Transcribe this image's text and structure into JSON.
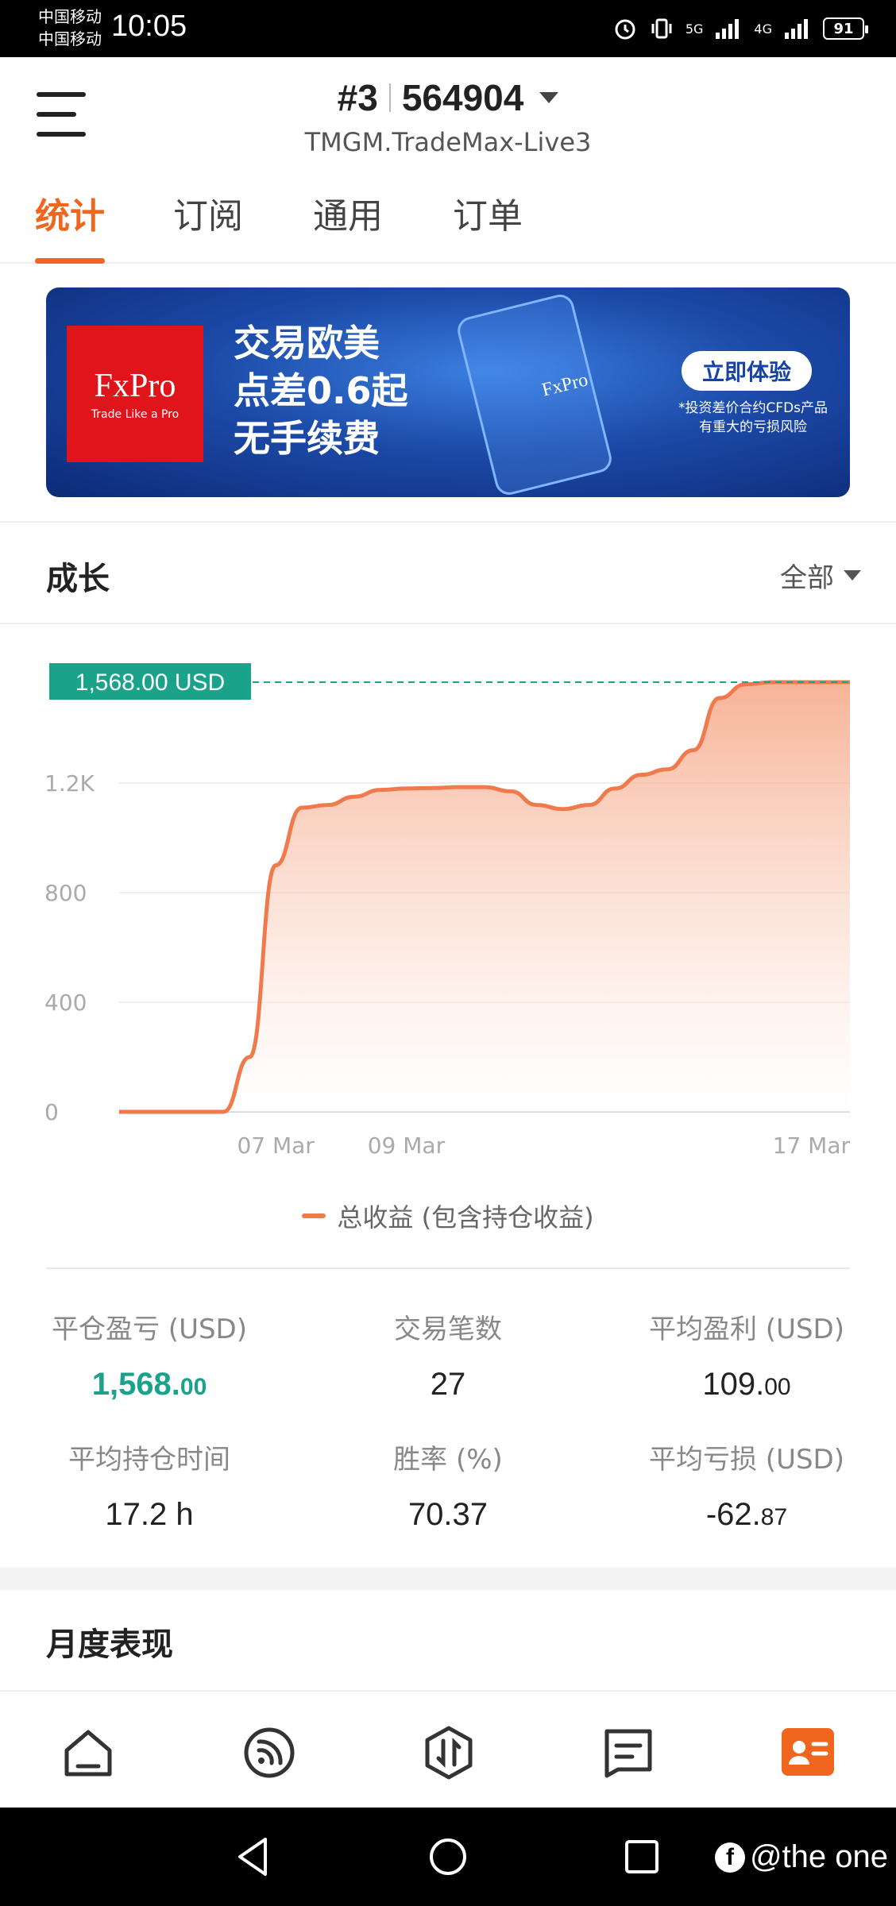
{
  "status_bar": {
    "carrier_1": "中国移动",
    "carrier_2": "中国移动",
    "time": "10:05",
    "battery": "91",
    "signal_labels": [
      "5G",
      "4G"
    ]
  },
  "header": {
    "account_prefix": "#3",
    "account_number": "564904",
    "server": "TMGM.TradeMax-Live3"
  },
  "tabs": [
    {
      "label": "统计",
      "active": true
    },
    {
      "label": "订阅",
      "active": false
    },
    {
      "label": "通用",
      "active": false
    },
    {
      "label": "订单",
      "active": false
    }
  ],
  "banner": {
    "logo": "FxPro",
    "logo_sub": "Trade Like a Pro",
    "headline_1": "交易欧美",
    "headline_2": "点差0.6起",
    "headline_3": "无手续费",
    "phone_logo": "FxPro",
    "cta": "立即体验",
    "disclaimer": "*投资差价合约CFDs产品有重大的亏损风险"
  },
  "growth": {
    "title": "成长",
    "filter": "全部",
    "legend": "总收益 (包含持仓收益)"
  },
  "chart_data": {
    "type": "area",
    "current_value_label": "1,568.00 USD",
    "y_ticks": [
      "0",
      "400",
      "800",
      "1.2K"
    ],
    "x_tick_labels": [
      "07 Mar",
      "09 Mar",
      "17 Mar"
    ],
    "ylim": [
      0,
      1600
    ],
    "series": [
      {
        "name": "总收益 (包含持仓收益)",
        "color": "#f07a4b",
        "values": [
          0,
          0,
          0,
          0,
          0,
          200,
          900,
          1110,
          1120,
          1150,
          1175,
          1180,
          1182,
          1185,
          1185,
          1170,
          1120,
          1105,
          1120,
          1180,
          1230,
          1250,
          1320,
          1510,
          1560,
          1568,
          1568,
          1568,
          1568
        ]
      }
    ],
    "grid": true
  },
  "stats": [
    {
      "label": "平仓盈亏 (USD)",
      "value_main": "1,568.",
      "value_dec": "00",
      "highlight": true
    },
    {
      "label": "交易笔数",
      "value_main": "27",
      "value_dec": "",
      "highlight": false
    },
    {
      "label": "平均盈利 (USD)",
      "value_main": "109.",
      "value_dec": "00",
      "highlight": false
    },
    {
      "label": "平均持仓时间",
      "value_main": "17.2 h",
      "value_dec": "",
      "highlight": false
    },
    {
      "label": "胜率 (%)",
      "value_main": "70.37",
      "value_dec": "",
      "highlight": false
    },
    {
      "label": "平均亏损 (USD)",
      "value_main": "-62.",
      "value_dec": "87",
      "highlight": false
    }
  ],
  "monthly": {
    "title": "月度表现"
  },
  "bottom_nav": [
    {
      "icon": "home-icon"
    },
    {
      "icon": "signal-icon"
    },
    {
      "icon": "trade-icon"
    },
    {
      "icon": "message-icon"
    },
    {
      "icon": "profile-icon",
      "active": true
    }
  ],
  "watermark": "@the one",
  "colors": {
    "accent": "#f0661f",
    "green": "#1aa28a",
    "chart_line": "#f07a4b"
  }
}
